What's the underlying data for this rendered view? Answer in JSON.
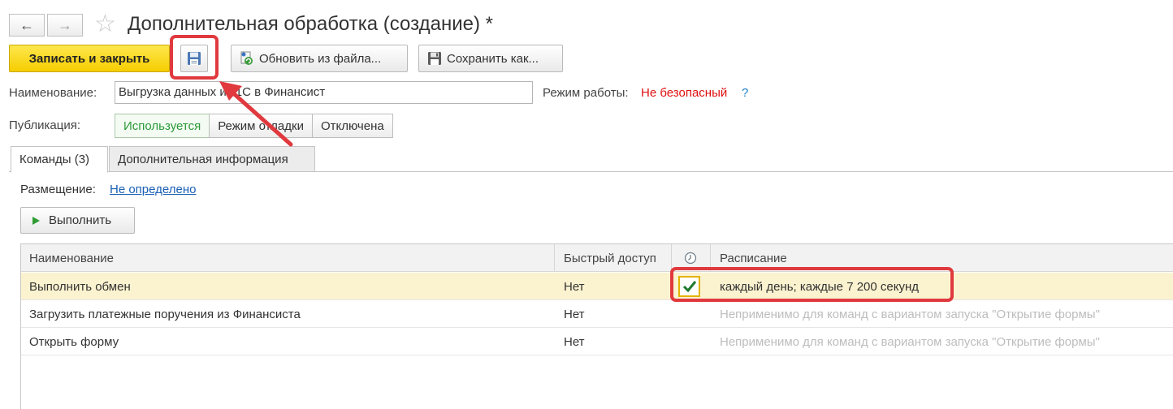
{
  "window": {
    "title": "Дополнительная обработка (создание) *",
    "back_glyph": "←",
    "forward_glyph": "→",
    "favorite_glyph": "☆"
  },
  "toolbar": {
    "save_close_label": "Записать и закрыть",
    "update_label": "Обновить из файла...",
    "save_as_label": "Сохранить как..."
  },
  "form": {
    "name_label": "Наименование:",
    "name_value": "Выгрузка данных из 1С в Финансист",
    "mode_label": "Режим работы:",
    "mode_value": "Не безопасный",
    "mode_help": "?",
    "publication_label": "Публикация:",
    "publication_options": [
      "Используется",
      "Режим отладки",
      "Отключена"
    ]
  },
  "tabs": [
    "Команды (3)",
    "Дополнительная информация"
  ],
  "placement": {
    "label": "Размещение:",
    "value": "Не определено"
  },
  "run_button": {
    "label": "Выполнить",
    "icon": "play-icon"
  },
  "commands_table": {
    "columns": [
      "Наименование",
      "Быстрый доступ",
      "clock-icon",
      "Расписание"
    ],
    "rows": [
      {
        "name": "Выполнить обмен",
        "quick_access": "Нет",
        "scheduled": true,
        "schedule": "каждый день; каждые 7 200 секунд"
      },
      {
        "name": "Загрузить платежные поручения из Финансиста",
        "quick_access": "Нет",
        "scheduled": false,
        "schedule": "Неприменимо для команд с вариантом запуска \"Открытие формы\""
      },
      {
        "name": "Открыть форму",
        "quick_access": "Нет",
        "scheduled": false,
        "schedule": "Неприменимо для команд с вариантом запуска \"Открытие формы\""
      }
    ]
  },
  "colors": {
    "accent_yellow": "#f5cd00",
    "annotation_red": "#e0393e",
    "active_green": "#2b9a3a",
    "link_blue": "#1a5fb4",
    "warning_red": "#e01010"
  }
}
